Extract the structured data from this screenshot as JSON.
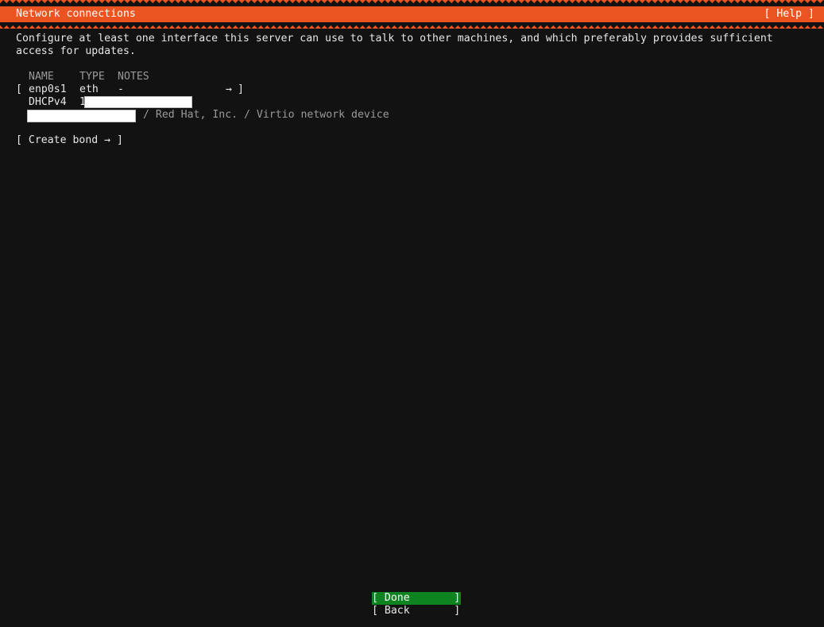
{
  "header": {
    "title": "Network connections",
    "help_label": "[ Help ]"
  },
  "intro": {
    "line1": "Configure at least one interface this server can use to talk to other machines, and which preferably provides sufficient",
    "line2": "access for updates."
  },
  "table": {
    "columns": [
      "NAME",
      "TYPE",
      "NOTES"
    ],
    "interface": {
      "open_bracket": "[",
      "name": "enp0s1",
      "type": "eth",
      "notes": "-",
      "arrow": "→",
      "close_bracket": "]"
    },
    "address": {
      "method": "DHCPv4",
      "value_prefix": "1"
    },
    "device_desc": "/ Red Hat, Inc. / Virtio network device"
  },
  "create_bond_label": "[ Create bond → ]",
  "buttons": {
    "done_label": "[ Done       ]",
    "back_label": "[ Back       ]"
  },
  "colors": {
    "accent": "#e95420",
    "background": "#121212",
    "focus": "#0e8420"
  }
}
